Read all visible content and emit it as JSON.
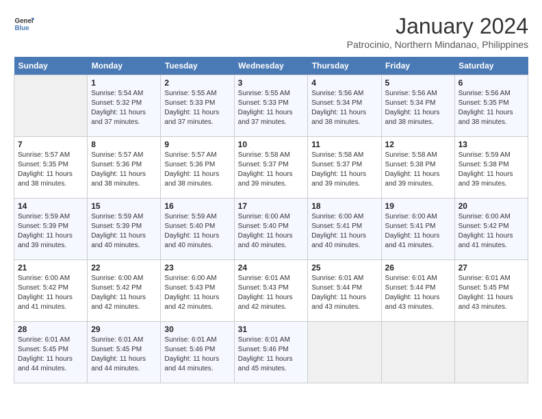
{
  "logo": {
    "text_general": "General",
    "text_blue": "Blue"
  },
  "title": "January 2024",
  "subtitle": "Patrocinio, Northern Mindanao, Philippines",
  "days_header": [
    "Sunday",
    "Monday",
    "Tuesday",
    "Wednesday",
    "Thursday",
    "Friday",
    "Saturday"
  ],
  "weeks": [
    [
      {
        "day": "",
        "sunrise": "",
        "sunset": "",
        "daylight": ""
      },
      {
        "day": "1",
        "sunrise": "Sunrise: 5:54 AM",
        "sunset": "Sunset: 5:32 PM",
        "daylight": "Daylight: 11 hours and 37 minutes."
      },
      {
        "day": "2",
        "sunrise": "Sunrise: 5:55 AM",
        "sunset": "Sunset: 5:33 PM",
        "daylight": "Daylight: 11 hours and 37 minutes."
      },
      {
        "day": "3",
        "sunrise": "Sunrise: 5:55 AM",
        "sunset": "Sunset: 5:33 PM",
        "daylight": "Daylight: 11 hours and 37 minutes."
      },
      {
        "day": "4",
        "sunrise": "Sunrise: 5:56 AM",
        "sunset": "Sunset: 5:34 PM",
        "daylight": "Daylight: 11 hours and 38 minutes."
      },
      {
        "day": "5",
        "sunrise": "Sunrise: 5:56 AM",
        "sunset": "Sunset: 5:34 PM",
        "daylight": "Daylight: 11 hours and 38 minutes."
      },
      {
        "day": "6",
        "sunrise": "Sunrise: 5:56 AM",
        "sunset": "Sunset: 5:35 PM",
        "daylight": "Daylight: 11 hours and 38 minutes."
      }
    ],
    [
      {
        "day": "7",
        "sunrise": "Sunrise: 5:57 AM",
        "sunset": "Sunset: 5:35 PM",
        "daylight": "Daylight: 11 hours and 38 minutes."
      },
      {
        "day": "8",
        "sunrise": "Sunrise: 5:57 AM",
        "sunset": "Sunset: 5:36 PM",
        "daylight": "Daylight: 11 hours and 38 minutes."
      },
      {
        "day": "9",
        "sunrise": "Sunrise: 5:57 AM",
        "sunset": "Sunset: 5:36 PM",
        "daylight": "Daylight: 11 hours and 38 minutes."
      },
      {
        "day": "10",
        "sunrise": "Sunrise: 5:58 AM",
        "sunset": "Sunset: 5:37 PM",
        "daylight": "Daylight: 11 hours and 39 minutes."
      },
      {
        "day": "11",
        "sunrise": "Sunrise: 5:58 AM",
        "sunset": "Sunset: 5:37 PM",
        "daylight": "Daylight: 11 hours and 39 minutes."
      },
      {
        "day": "12",
        "sunrise": "Sunrise: 5:58 AM",
        "sunset": "Sunset: 5:38 PM",
        "daylight": "Daylight: 11 hours and 39 minutes."
      },
      {
        "day": "13",
        "sunrise": "Sunrise: 5:59 AM",
        "sunset": "Sunset: 5:38 PM",
        "daylight": "Daylight: 11 hours and 39 minutes."
      }
    ],
    [
      {
        "day": "14",
        "sunrise": "Sunrise: 5:59 AM",
        "sunset": "Sunset: 5:39 PM",
        "daylight": "Daylight: 11 hours and 39 minutes."
      },
      {
        "day": "15",
        "sunrise": "Sunrise: 5:59 AM",
        "sunset": "Sunset: 5:39 PM",
        "daylight": "Daylight: 11 hours and 40 minutes."
      },
      {
        "day": "16",
        "sunrise": "Sunrise: 5:59 AM",
        "sunset": "Sunset: 5:40 PM",
        "daylight": "Daylight: 11 hours and 40 minutes."
      },
      {
        "day": "17",
        "sunrise": "Sunrise: 6:00 AM",
        "sunset": "Sunset: 5:40 PM",
        "daylight": "Daylight: 11 hours and 40 minutes."
      },
      {
        "day": "18",
        "sunrise": "Sunrise: 6:00 AM",
        "sunset": "Sunset: 5:41 PM",
        "daylight": "Daylight: 11 hours and 40 minutes."
      },
      {
        "day": "19",
        "sunrise": "Sunrise: 6:00 AM",
        "sunset": "Sunset: 5:41 PM",
        "daylight": "Daylight: 11 hours and 41 minutes."
      },
      {
        "day": "20",
        "sunrise": "Sunrise: 6:00 AM",
        "sunset": "Sunset: 5:42 PM",
        "daylight": "Daylight: 11 hours and 41 minutes."
      }
    ],
    [
      {
        "day": "21",
        "sunrise": "Sunrise: 6:00 AM",
        "sunset": "Sunset: 5:42 PM",
        "daylight": "Daylight: 11 hours and 41 minutes."
      },
      {
        "day": "22",
        "sunrise": "Sunrise: 6:00 AM",
        "sunset": "Sunset: 5:42 PM",
        "daylight": "Daylight: 11 hours and 42 minutes."
      },
      {
        "day": "23",
        "sunrise": "Sunrise: 6:00 AM",
        "sunset": "Sunset: 5:43 PM",
        "daylight": "Daylight: 11 hours and 42 minutes."
      },
      {
        "day": "24",
        "sunrise": "Sunrise: 6:01 AM",
        "sunset": "Sunset: 5:43 PM",
        "daylight": "Daylight: 11 hours and 42 minutes."
      },
      {
        "day": "25",
        "sunrise": "Sunrise: 6:01 AM",
        "sunset": "Sunset: 5:44 PM",
        "daylight": "Daylight: 11 hours and 43 minutes."
      },
      {
        "day": "26",
        "sunrise": "Sunrise: 6:01 AM",
        "sunset": "Sunset: 5:44 PM",
        "daylight": "Daylight: 11 hours and 43 minutes."
      },
      {
        "day": "27",
        "sunrise": "Sunrise: 6:01 AM",
        "sunset": "Sunset: 5:45 PM",
        "daylight": "Daylight: 11 hours and 43 minutes."
      }
    ],
    [
      {
        "day": "28",
        "sunrise": "Sunrise: 6:01 AM",
        "sunset": "Sunset: 5:45 PM",
        "daylight": "Daylight: 11 hours and 44 minutes."
      },
      {
        "day": "29",
        "sunrise": "Sunrise: 6:01 AM",
        "sunset": "Sunset: 5:45 PM",
        "daylight": "Daylight: 11 hours and 44 minutes."
      },
      {
        "day": "30",
        "sunrise": "Sunrise: 6:01 AM",
        "sunset": "Sunset: 5:46 PM",
        "daylight": "Daylight: 11 hours and 44 minutes."
      },
      {
        "day": "31",
        "sunrise": "Sunrise: 6:01 AM",
        "sunset": "Sunset: 5:46 PM",
        "daylight": "Daylight: 11 hours and 45 minutes."
      },
      {
        "day": "",
        "sunrise": "",
        "sunset": "",
        "daylight": ""
      },
      {
        "day": "",
        "sunrise": "",
        "sunset": "",
        "daylight": ""
      },
      {
        "day": "",
        "sunrise": "",
        "sunset": "",
        "daylight": ""
      }
    ]
  ]
}
